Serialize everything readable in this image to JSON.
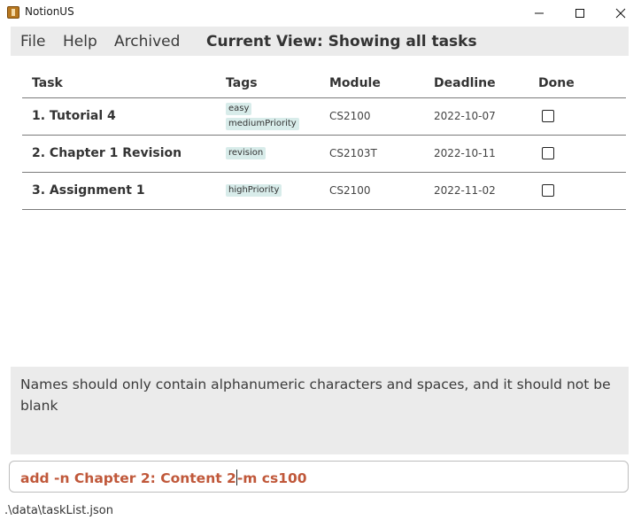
{
  "window": {
    "title": "NotionUS",
    "minimize_icon": "minimize-icon",
    "maximize_icon": "maximize-icon",
    "close_icon": "close-icon"
  },
  "menu": {
    "file": "File",
    "help": "Help",
    "archived": "Archived",
    "current_view": "Current View: Showing all tasks"
  },
  "table": {
    "headers": {
      "task": "Task",
      "tags": "Tags",
      "module": "Module",
      "deadline": "Deadline",
      "done": "Done"
    },
    "rows": [
      {
        "name": "1. Tutorial 4",
        "tags": [
          "easy",
          "mediumPriority"
        ],
        "module": "CS2100",
        "deadline": "2022-10-07",
        "done": false
      },
      {
        "name": "2. Chapter 1 Revision",
        "tags": [
          "revision"
        ],
        "module": "CS2103T",
        "deadline": "2022-10-11",
        "done": false
      },
      {
        "name": "3. Assignment 1",
        "tags": [
          "highPriority"
        ],
        "module": "CS2100",
        "deadline": "2022-11-02",
        "done": false
      }
    ]
  },
  "result": {
    "message": "Names should only contain alphanumeric characters and spaces, and it should not be blank"
  },
  "command": {
    "text_before_caret": "add -n Chapter 2: Content 2",
    "text_after_caret": "-m cs100"
  },
  "status": {
    "file_path": ".\\data\\taskList.json"
  },
  "colors": {
    "menu_background": "#ebebeb",
    "tag_background": "#d8ecea",
    "command_text": "#c0583a"
  }
}
